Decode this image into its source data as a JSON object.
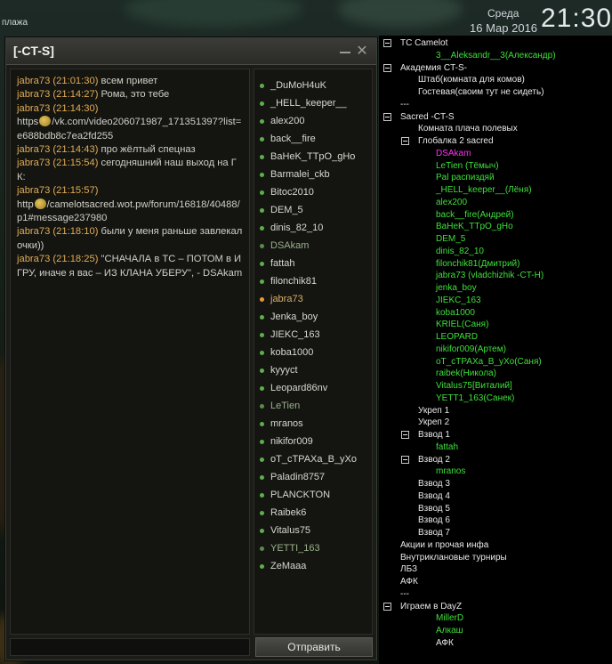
{
  "desktop": {
    "corner_text": "плажа",
    "clock_day": "Среда",
    "clock_date": "16 Мар 2016",
    "clock_time": "21:30"
  },
  "chat": {
    "title": "[-CT-S]",
    "send_label": "Отправить",
    "input_value": "",
    "messages": [
      {
        "author": "jabra73 (21:01:30)",
        "text": " всем привет"
      },
      {
        "author": "jabra73 (21:14:27)",
        "text": " Рома, это тебе"
      },
      {
        "author": "jabra73 (21:14:30)",
        "text": ""
      },
      {
        "author": "",
        "text": "https://vk.com/video206071987_171351397?list=e688bdb8c7ea2fd255",
        "smile": true
      },
      {
        "author": "jabra73 (21:14:43)",
        "text": " про жёлтый спецназ"
      },
      {
        "author": "jabra73 (21:15:54)",
        "text": " сегодняшний наш выход на ГК:"
      },
      {
        "author": "jabra73 (21:15:57)",
        "text": ""
      },
      {
        "author": "",
        "text": "http://camelotsacred.wot.pw/forum/16818/40488/p1#message237980",
        "smile": true
      },
      {
        "author": "jabra73 (21:18:10)",
        "text": " были у меня раньше завлекалочки))"
      },
      {
        "author": "jabra73 (21:18:25)",
        "text": " \"СНАЧАЛА в ТС – ПОТОМ в ИГРУ, иначе я вас – ИЗ КЛАНА УБЕРУ\", - DSAkam"
      }
    ],
    "members": [
      {
        "name": "_DuMoH4uK",
        "state": "online"
      },
      {
        "name": "_HELL_keeper__",
        "state": "online"
      },
      {
        "name": "alex200",
        "state": "online"
      },
      {
        "name": "back__fire",
        "state": "online"
      },
      {
        "name": "BaHeK_TTpO_gHo",
        "state": "online"
      },
      {
        "name": "Barmalei_ckb",
        "state": "online"
      },
      {
        "name": "Bitoc2010",
        "state": "online"
      },
      {
        "name": "DEM_5",
        "state": "online"
      },
      {
        "name": "dinis_82_10",
        "state": "online"
      },
      {
        "name": "DSAkam",
        "state": "dim"
      },
      {
        "name": "fattah",
        "state": "online"
      },
      {
        "name": "filonchik81",
        "state": "online"
      },
      {
        "name": "jabra73",
        "state": "self"
      },
      {
        "name": "Jenka_boy",
        "state": "online"
      },
      {
        "name": "JIEKC_163",
        "state": "online"
      },
      {
        "name": "koba1000",
        "state": "online"
      },
      {
        "name": "kyyyct",
        "state": "online"
      },
      {
        "name": "Leopard86nv",
        "state": "online"
      },
      {
        "name": "LeTien",
        "state": "dim"
      },
      {
        "name": "mranos",
        "state": "online"
      },
      {
        "name": "nikifor009",
        "state": "online"
      },
      {
        "name": "oT_cTPAXa_B_yXo",
        "state": "online"
      },
      {
        "name": "Paladin8757",
        "state": "online"
      },
      {
        "name": "PLANCKTON",
        "state": "online"
      },
      {
        "name": "Raibek6",
        "state": "online"
      },
      {
        "name": "Vitalus75",
        "state": "online"
      },
      {
        "name": "YETTI_163",
        "state": "dim"
      },
      {
        "name": "ZeMaaa",
        "state": "online"
      }
    ]
  },
  "tree": [
    {
      "level": 0,
      "toggle": true,
      "label": "TC Camelot",
      "color": "white"
    },
    {
      "level": 2,
      "toggle": false,
      "label": "3__Aleksandr__3(Александр)",
      "color": "green"
    },
    {
      "level": 0,
      "toggle": true,
      "label": "Академия CT-S-",
      "color": "white"
    },
    {
      "level": 1,
      "toggle": false,
      "label": "Штаб(комната для комов)",
      "color": "white"
    },
    {
      "level": 1,
      "toggle": false,
      "label": "Гостевая(своим тут не сидеть)",
      "color": "white"
    },
    {
      "level": 0,
      "toggle": false,
      "label": "---",
      "color": "white"
    },
    {
      "level": 0,
      "toggle": true,
      "label": "Sacred -CT-S",
      "color": "white"
    },
    {
      "level": 1,
      "toggle": false,
      "label": "Комната плача полевых",
      "color": "white"
    },
    {
      "level": 1,
      "toggle": true,
      "label": "Глобалка 2 sacred",
      "color": "white"
    },
    {
      "level": 2,
      "toggle": false,
      "label": "DSAkam",
      "color": "magenta"
    },
    {
      "level": 2,
      "toggle": false,
      "label": "LeTien (Тёмыч)",
      "color": "green"
    },
    {
      "level": 2,
      "toggle": false,
      "label": "Pal распиздяй",
      "color": "green"
    },
    {
      "level": 2,
      "toggle": false,
      "label": "_HELL_keeper__(Лёня)",
      "color": "green"
    },
    {
      "level": 2,
      "toggle": false,
      "label": "alex200",
      "color": "green"
    },
    {
      "level": 2,
      "toggle": false,
      "label": "back__fire(Андрей)",
      "color": "green"
    },
    {
      "level": 2,
      "toggle": false,
      "label": "BaHeK_TTpO_gHo",
      "color": "green"
    },
    {
      "level": 2,
      "toggle": false,
      "label": "DEM_5",
      "color": "green"
    },
    {
      "level": 2,
      "toggle": false,
      "label": "dinis_82_10",
      "color": "green"
    },
    {
      "level": 2,
      "toggle": false,
      "label": "filonchik81(Дмитрий)",
      "color": "green"
    },
    {
      "level": 2,
      "toggle": false,
      "label": "jabra73 (vladchizhik -CT-H)",
      "color": "green"
    },
    {
      "level": 2,
      "toggle": false,
      "label": "jenka_boy",
      "color": "green"
    },
    {
      "level": 2,
      "toggle": false,
      "label": "JIEKC_163",
      "color": "green"
    },
    {
      "level": 2,
      "toggle": false,
      "label": "koba1000",
      "color": "green"
    },
    {
      "level": 2,
      "toggle": false,
      "label": "KRIEL(Саня)",
      "color": "green"
    },
    {
      "level": 2,
      "toggle": false,
      "label": "LEOPARD",
      "color": "green"
    },
    {
      "level": 2,
      "toggle": false,
      "label": "nikifor009(Артем)",
      "color": "green"
    },
    {
      "level": 2,
      "toggle": false,
      "label": "oT_cTPAXa_B_yXo(Саня)",
      "color": "green"
    },
    {
      "level": 2,
      "toggle": false,
      "label": "raibek(Никола)",
      "color": "green"
    },
    {
      "level": 2,
      "toggle": false,
      "label": "Vitalus75[Виталий]",
      "color": "green"
    },
    {
      "level": 2,
      "toggle": false,
      "label": "YETT1_163(Санек)",
      "color": "green"
    },
    {
      "level": 1,
      "toggle": false,
      "label": "Укреп 1",
      "color": "white"
    },
    {
      "level": 1,
      "toggle": false,
      "label": "Укреп 2",
      "color": "white"
    },
    {
      "level": 1,
      "toggle": true,
      "label": "Взвод 1",
      "color": "white"
    },
    {
      "level": 2,
      "toggle": false,
      "label": "fattah",
      "color": "green"
    },
    {
      "level": 1,
      "toggle": true,
      "label": "Взвод 2",
      "color": "white"
    },
    {
      "level": 2,
      "toggle": false,
      "label": "mranos",
      "color": "green"
    },
    {
      "level": 1,
      "toggle": false,
      "label": "Взвод 3",
      "color": "white"
    },
    {
      "level": 1,
      "toggle": false,
      "label": "Взвод 4",
      "color": "white"
    },
    {
      "level": 1,
      "toggle": false,
      "label": "Взвод 5",
      "color": "white"
    },
    {
      "level": 1,
      "toggle": false,
      "label": "Взвод 6",
      "color": "white"
    },
    {
      "level": 1,
      "toggle": false,
      "label": "Взвод 7",
      "color": "white"
    },
    {
      "level": 0,
      "toggle": false,
      "label": "Акции и прочая инфа",
      "color": "white"
    },
    {
      "level": 0,
      "toggle": false,
      "label": "Внутриклановые турниры",
      "color": "white"
    },
    {
      "level": 0,
      "toggle": false,
      "label": "ЛБЗ",
      "color": "white"
    },
    {
      "level": 0,
      "toggle": false,
      "label": "АФК",
      "color": "white"
    },
    {
      "level": 0,
      "toggle": false,
      "label": "---",
      "color": "white"
    },
    {
      "level": 0,
      "toggle": true,
      "label": "Играем в DayZ",
      "color": "white"
    },
    {
      "level": 1,
      "toggle": false,
      "label": "MillerD",
      "color": "green",
      "indent_extra": true
    },
    {
      "level": 1,
      "toggle": false,
      "label": "Алкаш",
      "color": "green",
      "indent_extra": true
    },
    {
      "level": 1,
      "toggle": false,
      "label": "АФК",
      "color": "white",
      "indent_extra": true
    }
  ]
}
